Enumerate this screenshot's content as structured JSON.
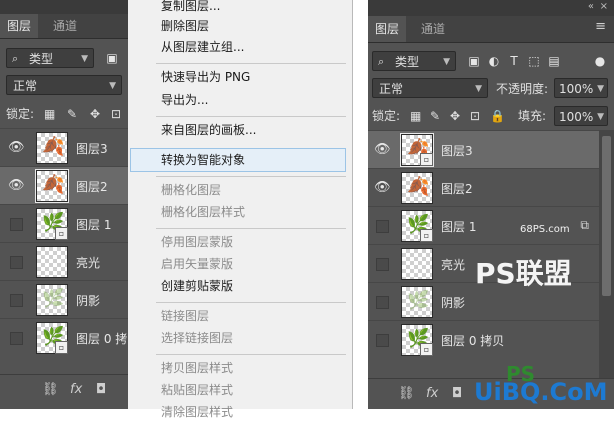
{
  "left_panel": {
    "tabs": [
      "图层",
      "通道"
    ],
    "filter_label": "类型",
    "blend_mode": "正常",
    "lock_label": "锁定:",
    "layers": [
      {
        "name": "图层3",
        "visible": true,
        "selected": false
      },
      {
        "name": "图层2",
        "visible": true,
        "selected": true
      },
      {
        "name": "图层 1",
        "visible": false,
        "selected": false
      },
      {
        "name": "亮光",
        "visible": false,
        "selected": false
      },
      {
        "name": "阴影",
        "visible": false,
        "selected": false
      },
      {
        "name": "图层 0 拷",
        "visible": false,
        "selected": false
      }
    ],
    "bottom_fx": "fx"
  },
  "menu": {
    "items": [
      {
        "label": "复制图层...",
        "disabled": false
      },
      {
        "label": "删除图层",
        "disabled": false
      },
      {
        "label": "从图层建立组...",
        "disabled": false
      },
      {
        "label": "快速导出为 PNG",
        "disabled": false
      },
      {
        "label": "导出为...",
        "disabled": false
      },
      {
        "label": "来自图层的画板...",
        "disabled": false
      },
      {
        "label": "转换为智能对象",
        "disabled": false,
        "highlighted": true
      },
      {
        "label": "栅格化图层",
        "disabled": true
      },
      {
        "label": "栅格化图层样式",
        "disabled": true
      },
      {
        "label": "停用图层蒙版",
        "disabled": true
      },
      {
        "label": "启用矢量蒙版",
        "disabled": true
      },
      {
        "label": "创建剪贴蒙版",
        "disabled": false
      },
      {
        "label": "链接图层",
        "disabled": true
      },
      {
        "label": "选择链接图层",
        "disabled": true
      },
      {
        "label": "拷贝图层样式",
        "disabled": true
      },
      {
        "label": "粘贴图层样式",
        "disabled": true
      },
      {
        "label": "清除图层样式",
        "disabled": true
      }
    ]
  },
  "right_panel": {
    "tabs": [
      "图层",
      "通道"
    ],
    "collapse_icon": "«",
    "close_icon": "×",
    "filter_label": "类型",
    "blend_mode": "正常",
    "opacity_label": "不透明度:",
    "opacity_value": "100%",
    "lock_label": "锁定:",
    "fill_label": "填充:",
    "fill_value": "100%",
    "layers": [
      {
        "name": "图层3",
        "visible": true,
        "selected": true
      },
      {
        "name": "图层2",
        "visible": true,
        "selected": false
      },
      {
        "name": "图层 1",
        "visible": false,
        "selected": false
      },
      {
        "name": "亮光",
        "visible": false,
        "selected": false
      },
      {
        "name": "阴影",
        "visible": false,
        "selected": false
      },
      {
        "name": "图层 0 拷贝",
        "visible": false,
        "selected": false
      }
    ],
    "bottom_fx": "fx"
  },
  "watermarks": {
    "site": "68PS.com",
    "brand": "PS联盟",
    "bottom_brand": "UiBQ.CoM",
    "bottom_ps": "PS"
  }
}
